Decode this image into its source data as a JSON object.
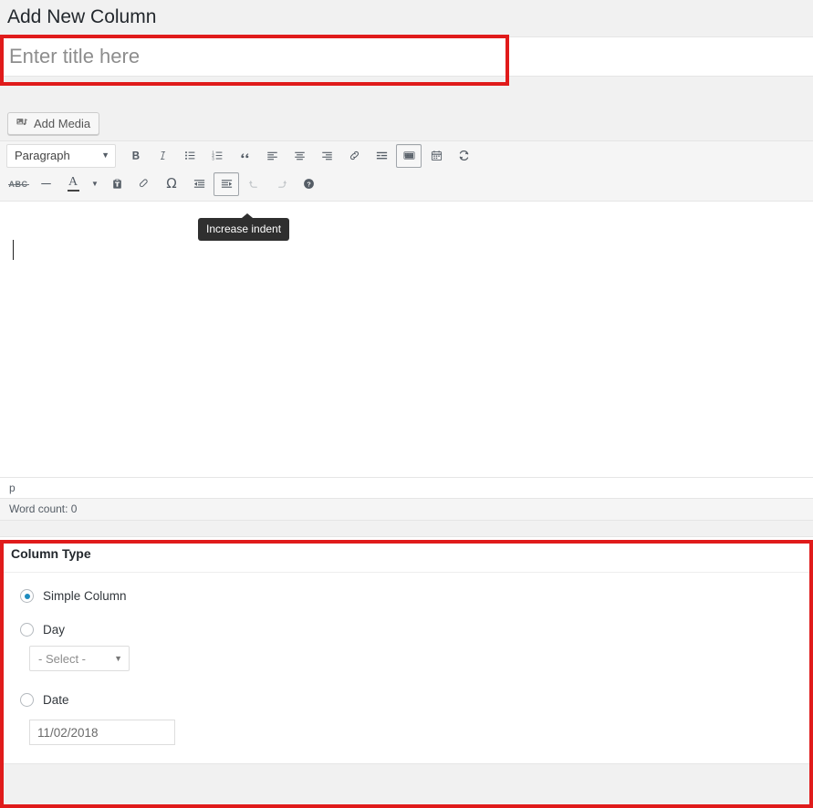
{
  "page": {
    "title": "Add New Column"
  },
  "title_field": {
    "value": "",
    "placeholder": "Enter title here"
  },
  "media": {
    "add_media_label": "Add Media",
    "add_media_icon": "media-icon"
  },
  "editor": {
    "format_select": {
      "selected": "Paragraph",
      "caret_icon": "chevron-down-icon"
    },
    "toolbar_row1": [
      {
        "name": "bold-button",
        "icon": "bold-icon",
        "title": "Bold",
        "state": "normal"
      },
      {
        "name": "italic-button",
        "icon": "italic-icon",
        "title": "Italic",
        "state": "normal"
      },
      {
        "name": "bulleted-list-button",
        "icon": "bulleted-list-icon",
        "title": "Bulleted list",
        "state": "normal"
      },
      {
        "name": "numbered-list-button",
        "icon": "numbered-list-icon",
        "title": "Numbered list",
        "state": "normal"
      },
      {
        "name": "blockquote-button",
        "icon": "blockquote-icon",
        "title": "Blockquote",
        "state": "normal"
      },
      {
        "name": "align-left-button",
        "icon": "align-left-icon",
        "title": "Align left",
        "state": "normal"
      },
      {
        "name": "align-center-button",
        "icon": "align-center-icon",
        "title": "Align center",
        "state": "normal"
      },
      {
        "name": "align-right-button",
        "icon": "align-right-icon",
        "title": "Align right",
        "state": "normal"
      },
      {
        "name": "insert-link-button",
        "icon": "link-icon",
        "title": "Insert/edit link",
        "state": "normal"
      },
      {
        "name": "read-more-button",
        "icon": "read-more-icon",
        "title": "Insert Read More tag",
        "state": "normal"
      },
      {
        "name": "toolbar-toggle-button",
        "icon": "keyboard-icon",
        "title": "Toolbar Toggle",
        "state": "active"
      },
      {
        "name": "calendar-button",
        "icon": "calendar-icon",
        "title": "Calendar",
        "state": "normal"
      },
      {
        "name": "refresh-button",
        "icon": "refresh-icon",
        "title": "Refresh",
        "state": "normal"
      }
    ],
    "toolbar_row2": [
      {
        "name": "strikethrough-button",
        "icon": "abc-strikethrough-icon",
        "title": "Strikethrough",
        "state": "normal"
      },
      {
        "name": "horizontal-line-button",
        "icon": "horizontal-line-icon",
        "title": "Horizontal line",
        "state": "normal"
      },
      {
        "name": "text-color-button",
        "icon": "text-color-a-icon",
        "title": "Text color",
        "state": "normal"
      },
      {
        "name": "text-color-caret",
        "icon": "chevron-down-icon",
        "title": "Text color options",
        "state": "normal"
      },
      {
        "name": "paste-as-text-button",
        "icon": "paste-as-text-icon",
        "title": "Paste as text",
        "state": "normal"
      },
      {
        "name": "clear-formatting-button",
        "icon": "eraser-icon",
        "title": "Clear formatting",
        "state": "normal"
      },
      {
        "name": "special-character-button",
        "icon": "omega-icon",
        "title": "Special character",
        "state": "normal"
      },
      {
        "name": "decrease-indent-button",
        "icon": "decrease-indent-icon",
        "title": "Decrease indent",
        "state": "normal"
      },
      {
        "name": "increase-indent-button",
        "icon": "increase-indent-icon",
        "title": "Increase indent",
        "state": "active"
      },
      {
        "name": "undo-button",
        "icon": "undo-icon",
        "title": "Undo",
        "state": "disabled"
      },
      {
        "name": "redo-button",
        "icon": "redo-icon",
        "title": "Redo",
        "state": "disabled"
      },
      {
        "name": "keyboard-shortcuts-button",
        "icon": "help-icon",
        "title": "Keyboard Shortcuts",
        "state": "normal"
      }
    ],
    "tooltip": "Increase indent",
    "content": "",
    "path_status": "p",
    "word_count": "Word count: 0"
  },
  "column_type": {
    "header": "Column Type",
    "options": [
      {
        "label": "Simple Column",
        "selected": true
      },
      {
        "label": "Day",
        "selected": false
      },
      {
        "label": "Date",
        "selected": false
      }
    ],
    "day_select": {
      "selected": "- Select -",
      "caret_icon": "chevron-down-icon"
    },
    "date_field": {
      "value": "11/02/2018"
    }
  },
  "highlights": {
    "title_box_color": "#e01b1b",
    "column_type_box_color": "#e01b1b"
  }
}
